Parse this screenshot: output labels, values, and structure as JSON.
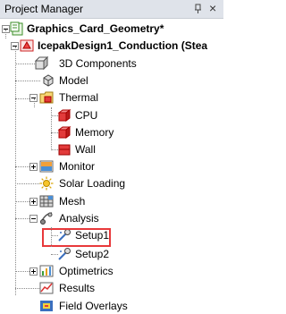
{
  "panel": {
    "title": "Project Manager",
    "pin_icon": "pin-icon",
    "close_icon": "close-icon"
  },
  "tree": {
    "project": "Graphics_Card_Geometry*",
    "design": "IcepakDesign1_Conduction (Stea",
    "items": {
      "components3d": "3D Components",
      "model": "Model",
      "thermal": "Thermal",
      "cpu": "CPU",
      "memory": "Memory",
      "wall": "Wall",
      "monitor": "Monitor",
      "solar_loading": "Solar Loading",
      "mesh": "Mesh",
      "analysis": "Analysis",
      "setup1": "Setup1",
      "setup2": "Setup2",
      "optimetrics": "Optimetrics",
      "results": "Results",
      "field_overlays": "Field Overlays"
    }
  },
  "colors": {
    "highlight_box": "#e8393b",
    "titlebar_bg": "#dfe3ea",
    "boundary_red": "#e23b3b"
  }
}
